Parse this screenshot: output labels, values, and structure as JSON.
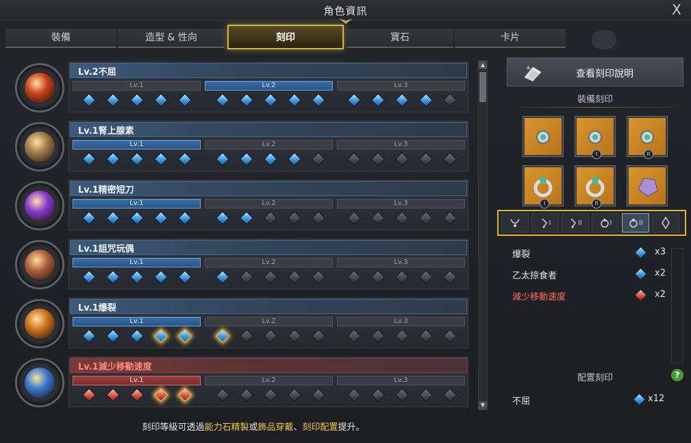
{
  "window": {
    "title": "角色資訊",
    "close_label": "X"
  },
  "tabs": [
    {
      "label": "裝備",
      "active": false
    },
    {
      "label": "造型 & 性向",
      "active": false
    },
    {
      "label": "刻印",
      "active": true
    },
    {
      "label": "寶石",
      "active": false
    },
    {
      "label": "卡片",
      "active": false
    }
  ],
  "engravings": [
    {
      "name": "Lv.2不屈",
      "negative": false,
      "levels": [
        "Lv.1",
        "Lv.2",
        "Lv.3"
      ],
      "active_level": 2,
      "filled": 14,
      "glow": [],
      "icon": "unyielding-engraving-icon",
      "icon_color": "#c8401c"
    },
    {
      "name": "Lv.1腎上腺素",
      "negative": false,
      "levels": [
        "Lv.1",
        "Lv.2",
        "Lv.3"
      ],
      "active_level": 1,
      "filled": 9,
      "glow": [],
      "icon": "adrenaline-engraving-icon",
      "icon_color": "#a07a4a"
    },
    {
      "name": "Lv.1精密短刀",
      "negative": false,
      "levels": [
        "Lv.1",
        "Lv.2",
        "Lv.3"
      ],
      "active_level": 1,
      "filled": 7,
      "glow": [],
      "icon": "precise-dagger-engraving-icon",
      "icon_color": "#8a3ad0"
    },
    {
      "name": "Lv.1詛咒玩偶",
      "negative": false,
      "levels": [
        "Lv.1",
        "Lv.2",
        "Lv.3"
      ],
      "active_level": 1,
      "filled": 6,
      "glow": [],
      "icon": "cursed-doll-engraving-icon",
      "icon_color": "#b0603a"
    },
    {
      "name": "Lv.1爆裂",
      "negative": false,
      "levels": [
        "Lv.1",
        "Lv.2",
        "Lv.3"
      ],
      "active_level": 1,
      "filled": 6,
      "glow": [
        3,
        4,
        5
      ],
      "icon": "burst-engraving-icon",
      "icon_color": "#d0701c"
    },
    {
      "name": "Lv.1減少移動速度",
      "negative": true,
      "levels": [
        "Lv.1",
        "Lv.2",
        "Lv.3"
      ],
      "active_level": 1,
      "filled": 5,
      "glow": [
        3,
        4
      ],
      "icon": "move-speed-reduction-engraving-icon",
      "icon_color": "#3a7ad0"
    }
  ],
  "footer": {
    "part1": "刻印等級可透過",
    "hl1": "能力石精製",
    "part2": "或",
    "hl2": "飾品穿戴",
    "part3": "、",
    "hl3": "刻印配置",
    "part4": "提升。"
  },
  "right": {
    "view_button": "查看刻印說明",
    "equipped_title": "裝備刻印",
    "slots": [
      {
        "name": "necklace-slot",
        "badge": ""
      },
      {
        "name": "earring-1-slot",
        "badge": "I"
      },
      {
        "name": "earring-2-slot",
        "badge": "II"
      },
      {
        "name": "ring-1-slot",
        "badge": "I"
      },
      {
        "name": "ring-2-slot",
        "badge": "II"
      },
      {
        "name": "ability-stone-slot",
        "badge": ""
      }
    ],
    "filters": [
      {
        "name": "filter-necklace",
        "label": "",
        "active": false
      },
      {
        "name": "filter-earring-1",
        "label": "I",
        "active": false
      },
      {
        "name": "filter-earring-2",
        "label": "II",
        "active": false
      },
      {
        "name": "filter-ring-1",
        "label": "I",
        "active": false
      },
      {
        "name": "filter-ring-2",
        "label": "II",
        "active": true
      },
      {
        "name": "filter-ability-stone",
        "label": "",
        "active": false
      }
    ],
    "effects": [
      {
        "name": "爆裂",
        "count": "x3",
        "negative": false
      },
      {
        "name": "乙太掠食者",
        "count": "x2",
        "negative": false
      },
      {
        "name": "減少移動速度",
        "count": "x2",
        "negative": true
      }
    ],
    "config_title": "配置刻印",
    "help_label": "?",
    "config": {
      "name": "不屈",
      "count": "x12"
    }
  },
  "colors": {
    "accent_gold": "#e0b830",
    "gem_blue": "#3fa0ea",
    "gem_red": "#e05a4a",
    "negative_text": "#ff6a5a"
  }
}
